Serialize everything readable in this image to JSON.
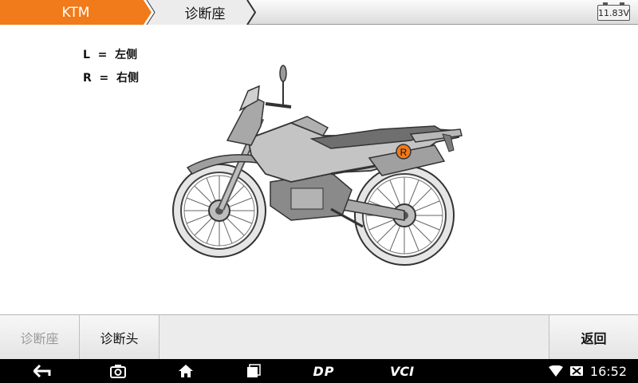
{
  "header": {
    "brand_tab": "KTM",
    "current_tab": "诊断座",
    "battery_voltage": "11.83V",
    "colors": {
      "brand_tab_bg": "#f17a1a",
      "accent": "#f17a1a"
    }
  },
  "legend": {
    "left": "L  =  左侧",
    "right": "R  =  右侧"
  },
  "diagram": {
    "marker_label": "R",
    "marker_color": "#f17a1a"
  },
  "function_bar": {
    "seat_label": "诊断座",
    "head_label": "诊断头",
    "back_label": "返回"
  },
  "navbar": {
    "dp_label": "DP",
    "vci_label": "VCI",
    "time": "16:52",
    "icons": [
      "back-icon",
      "camera-icon",
      "home-icon",
      "recent-apps-icon",
      "wifi-icon",
      "no-sim-icon"
    ]
  }
}
